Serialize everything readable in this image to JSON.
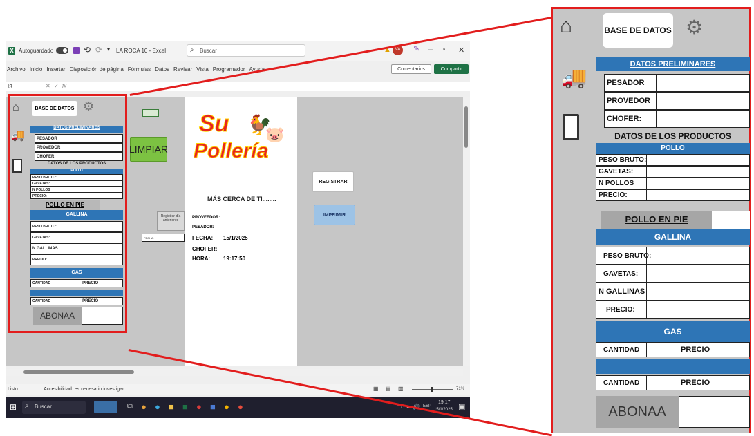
{
  "excel": {
    "title_bar": {
      "autosave_label": "Autoguardado",
      "doc_title": "LA ROCA 10 - Excel",
      "search_placeholder": "Buscar",
      "avatar_initials": "VA"
    },
    "ribbon_tabs": [
      "Archivo",
      "Inicio",
      "Insertar",
      "Disposición de página",
      "Fórmulas",
      "Datos",
      "Revisar",
      "Vista",
      "Programador",
      "Ayuda"
    ],
    "comentarios_label": "Comentarios",
    "compartir_label": "Compartir",
    "name_box": "I3",
    "fx_label": "fx",
    "sheet": {
      "base_datos_label": "BASE DE DATOS",
      "datos_preliminares": "DATOS PRELIMINARES",
      "pesador": "PESADOR",
      "provedor": "PROVEDOR",
      "chofer": "CHOFER:",
      "datos_productos": "DATOS DE LOS PRODUCTOS",
      "pollo": "POLLO",
      "peso_bruto": "PESO BRUTO:",
      "gavetas": "GAVETAS:",
      "n_pollos": "N POLLOS",
      "precio": "PRECIO:",
      "pollo_en_pie": "POLLO EN PIE",
      "gallina": "GALLINA",
      "n_gallinas": "N GALLINAS",
      "gas": "GAS",
      "cantidad": "CANTIDAD",
      "precio_caps": "PRECIO",
      "abonaa": "ABONAA",
      "limpiar": "LIMPIAR",
      "registrar_dia": "Registrar día anteriores",
      "fecha_small": "FECHA:",
      "registrar": "REGISTRAR",
      "imprimir": "IMPRIMIR"
    },
    "receipt": {
      "logo_line1": "Su",
      "logo_line2": "Pollería",
      "slogan": "MÁS CERCA DE TI........",
      "proveedor": "PROVEEDOR:",
      "pesador": "PESADOR:",
      "fecha_label": "FECHA:",
      "fecha_value": "15/1/2025",
      "chofer": "CHOFER:",
      "hora_label": "HORA:",
      "hora_value": "19:17:50"
    },
    "status_bar": {
      "ready": "Listo",
      "accessibility": "Accesibilidad: es necesario investigar",
      "zoom": "71%"
    },
    "taskbar": {
      "search_placeholder": "Buscar",
      "lang": "ESP",
      "time": "19:17",
      "date": "15/1/2025"
    }
  },
  "zoom_panel": {
    "base_datos_label": "BASE DE DATOS",
    "datos_preliminares": "DATOS PRELIMINARES",
    "pesador": "PESADOR",
    "provedor": "PROVEDOR",
    "chofer": "CHOFER:",
    "datos_productos": "DATOS DE LOS PRODUCTOS",
    "pollo": "POLLO",
    "peso_bruto": "PESO BRUTO:",
    "gavetas": "GAVETAS:",
    "n_pollos": "N POLLOS",
    "precio": "PRECIO:",
    "pollo_en_pie": "POLLO EN PIE",
    "gallina": "GALLINA",
    "peso_bruto2": "PESO BRUTO:",
    "gavetas2": "GAVETAS:",
    "n_gallinas": "N GALLINAS",
    "precio2": "PRECIO:",
    "gas": "GAS",
    "cantidad": "CANTIDAD",
    "precio_caps": "PRECIO",
    "cantidad2": "CANTIDAD",
    "precio_caps2": "PRECIO",
    "abonaa": "ABONAA"
  },
  "colors": {
    "highlight_red": "#e21d1d",
    "blue_header": "#2e75b6",
    "green_button": "#7cc242",
    "excel_green": "#1e7145"
  }
}
